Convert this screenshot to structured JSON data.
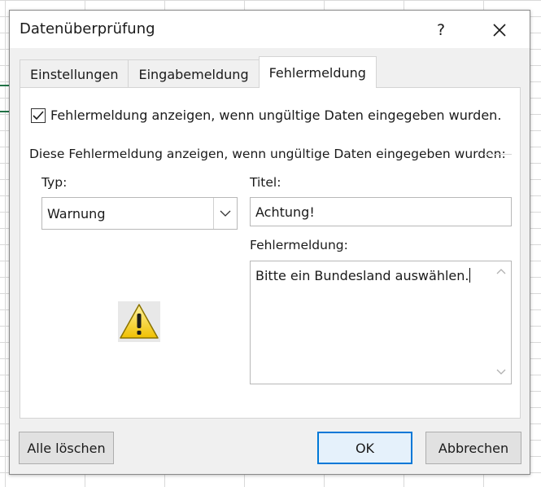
{
  "dialog": {
    "title": "Datenüberprüfung",
    "help_label": "?",
    "close_icon": "close-icon"
  },
  "tabs": [
    {
      "label": "Einstellungen",
      "active": false
    },
    {
      "label": "Eingabemeldung",
      "active": false
    },
    {
      "label": "Fehlermeldung",
      "active": true
    }
  ],
  "error_tab": {
    "show_error_checkbox": {
      "label": "Fehlermeldung anzeigen, wenn ungültige Daten eingegeben wurden.",
      "checked": true
    },
    "section_label": "Diese Fehlermeldung anzeigen, wenn ungültige Daten eingegeben wurden:",
    "type": {
      "label": "Typ:",
      "value": "Warnung"
    },
    "title_field": {
      "label": "Titel:",
      "value": "Achtung!"
    },
    "message_field": {
      "label": "Fehlermeldung:",
      "value": "Bitte ein Bundesland auswählen."
    },
    "icon": "warning-icon"
  },
  "buttons": {
    "clear_all": "Alle löschen",
    "ok": "OK",
    "cancel": "Abbrechen"
  },
  "colors": {
    "dialog_bg": "#f0f0f0",
    "panel_bg": "#ffffff",
    "default_button_border": "#0078d7",
    "warning_yellow": "#f5d000"
  }
}
